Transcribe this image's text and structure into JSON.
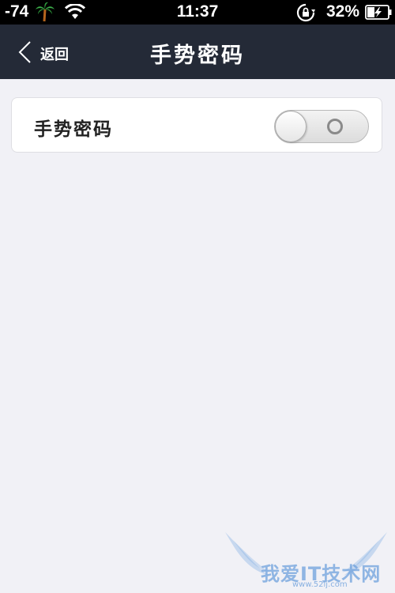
{
  "status_bar": {
    "signal": "-74",
    "time": "11:37",
    "battery_percent": "32%",
    "icons": [
      "palm-tree-icon",
      "wifi-icon",
      "rotation-lock-icon",
      "battery-charging-icon"
    ]
  },
  "nav": {
    "back_label": "返回",
    "title": "手势密码"
  },
  "settings": {
    "gesture_password_label": "手势密码",
    "gesture_password_enabled": false
  },
  "watermark": {
    "text": "我爱IT技术网",
    "url": "www.52ij.com"
  },
  "colors": {
    "nav_background": "#242a37",
    "page_background": "#f1f1f6",
    "card_background": "#ffffff"
  }
}
